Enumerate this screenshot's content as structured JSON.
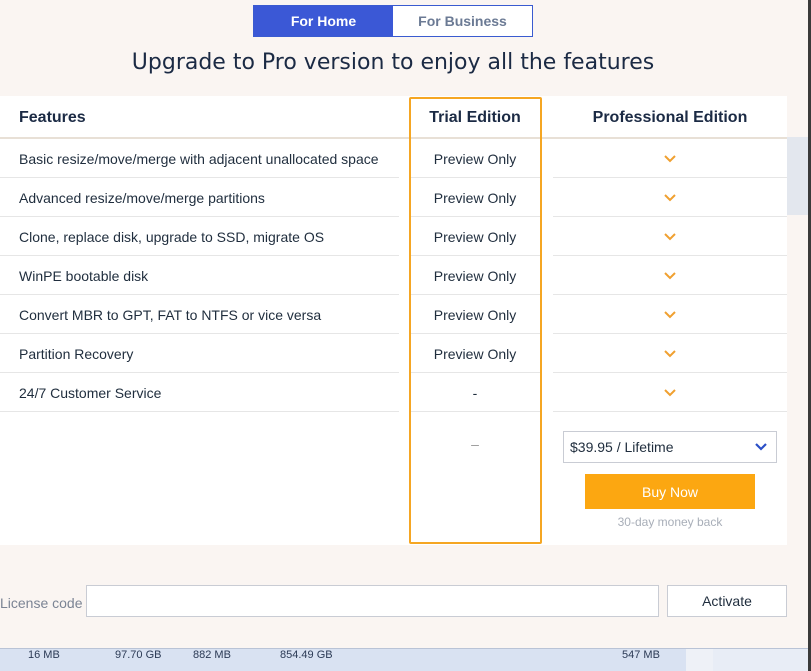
{
  "tabs": [
    {
      "label": "For Home",
      "active": true
    },
    {
      "label": "For Business",
      "active": false
    }
  ],
  "headline": "Upgrade to Pro version to enjoy all the features",
  "table": {
    "headers": {
      "features": "Features",
      "trial": "Trial Edition",
      "pro": "Professional Edition"
    },
    "rows": [
      {
        "feature": "Basic resize/move/merge with adjacent unallocated space",
        "trial": "Preview Only",
        "pro": "check-icon"
      },
      {
        "feature": "Advanced resize/move/merge partitions",
        "trial": "Preview Only",
        "pro": "check-icon"
      },
      {
        "feature": "Clone, replace disk, upgrade to SSD, migrate OS",
        "trial": "Preview Only",
        "pro": "check-icon"
      },
      {
        "feature": "WinPE bootable disk",
        "trial": "Preview Only",
        "pro": "check-icon"
      },
      {
        "feature": "Convert MBR to GPT, FAT to NTFS or vice versa",
        "trial": "Preview Only",
        "pro": "check-icon"
      },
      {
        "feature": "Partition Recovery",
        "trial": "Preview Only",
        "pro": "check-icon"
      },
      {
        "feature": "24/7 Customer Service",
        "trial": "-",
        "pro": "check-icon"
      }
    ],
    "trial_price": "–",
    "price_option": "$39.95 / Lifetime",
    "buy_label": "Buy Now",
    "money_back": "30-day money back"
  },
  "license": {
    "label": "License code",
    "value": "",
    "placeholder": "",
    "activate_label": "Activate"
  },
  "background_strip": [
    "16 MB",
    "97.70 GB",
    "882 MB",
    "854.49 GB",
    "547 MB"
  ],
  "colors": {
    "accent_blue": "#3b58d6",
    "highlight_orange": "#f5a623",
    "buy_orange": "#fca711",
    "check_orange": "#f0a030"
  }
}
